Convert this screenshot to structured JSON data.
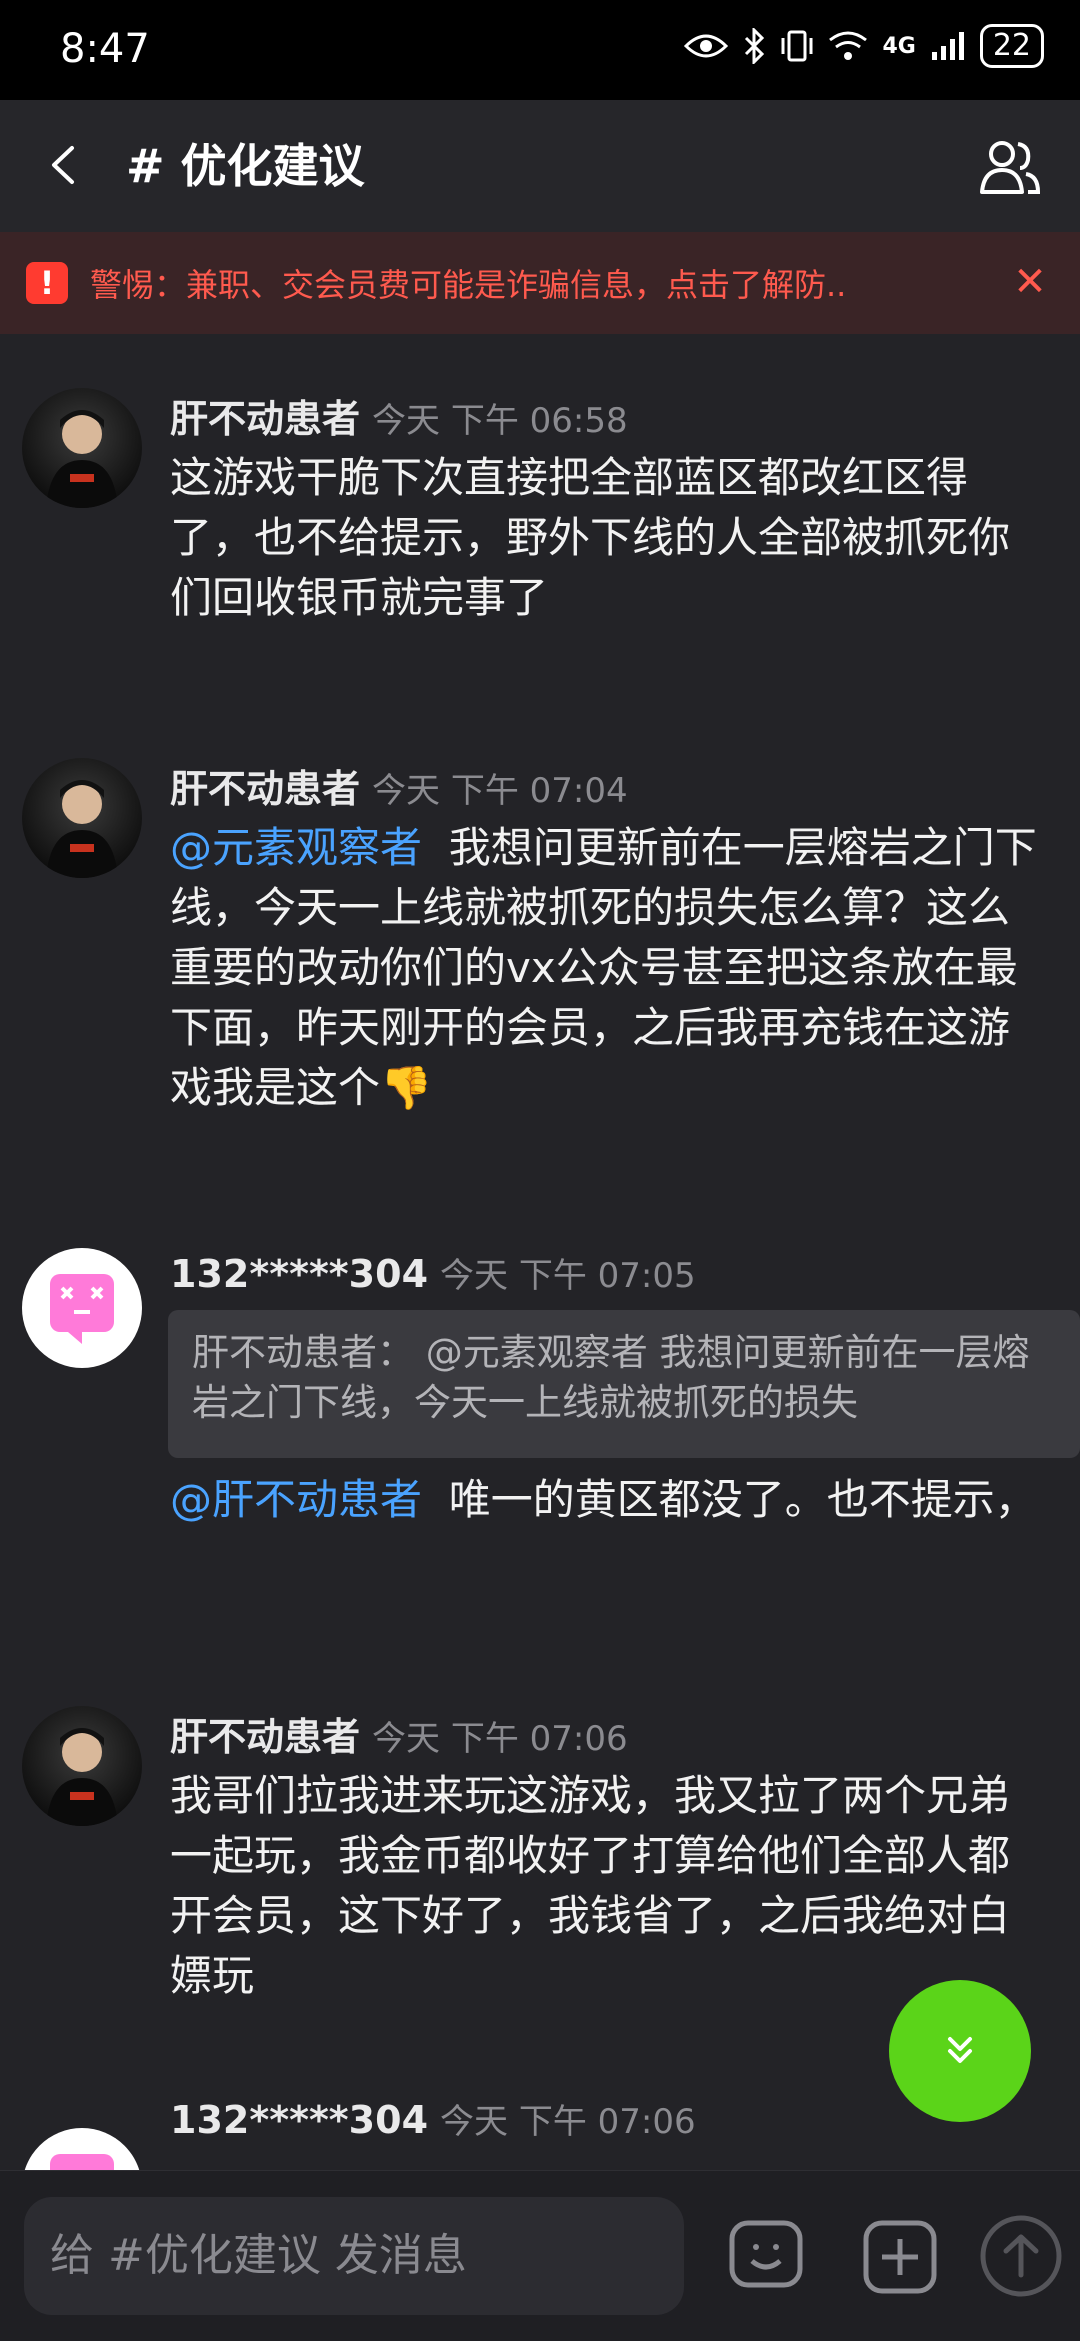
{
  "status": {
    "time": "8:47",
    "network": "4G",
    "battery": "22"
  },
  "header": {
    "title": "# 优化建议"
  },
  "warning": {
    "text": "警惕：兼职、交会员费可能是诈骗信息，点击了解防.."
  },
  "messages": [
    {
      "name": "肝不动患者",
      "time": "今天 下午 06:58",
      "body": "这游戏干脆下次直接把全部蓝区都改红区得了，也不给提示，野外下线的人全部被抓死你们回收银币就完事了"
    },
    {
      "name": "肝不动患者",
      "time": "今天 下午 07:04",
      "mention": "@元素观察者",
      "body": "我想问更新前在一层熔岩之门下线，今天一上线就被抓死的损失怎么算？这么重要的改动你们的vx公众号甚至把这条放在最下面，昨天刚开的会员，之后我再充钱在这游戏我是这个👎"
    },
    {
      "name": "132*****304",
      "time": "今天 下午 07:05",
      "quote": "肝不动患者： @元素观察者 我想问更新前在一层熔岩之门下线，今天一上线就被抓死的损失",
      "mention": "@肝不动患者",
      "body": "唯一的黄区都没了。也不提示，"
    },
    {
      "name": "肝不动患者",
      "time": "今天 下午 07:06",
      "body": "我哥们拉我进来玩这游戏，我又拉了两个兄弟一起玩，我金币都收好了打算给他们全部人都开会员，这下好了，我钱省了，之后我绝对白嫖玩"
    },
    {
      "name": "132*****304",
      "time": "今天 下午 07:06"
    }
  ],
  "composer": {
    "placeholder": "给 #优化建议 发消息"
  },
  "colors": {
    "accent_green": "#5bd419",
    "mention_blue": "#4aa3ff",
    "warning_red": "#ff5a4e"
  },
  "icons": [
    "back-icon",
    "members-icon",
    "warning-icon",
    "close-icon",
    "scroll-down-icon",
    "emoji-icon",
    "plus-icon",
    "send-icon"
  ]
}
